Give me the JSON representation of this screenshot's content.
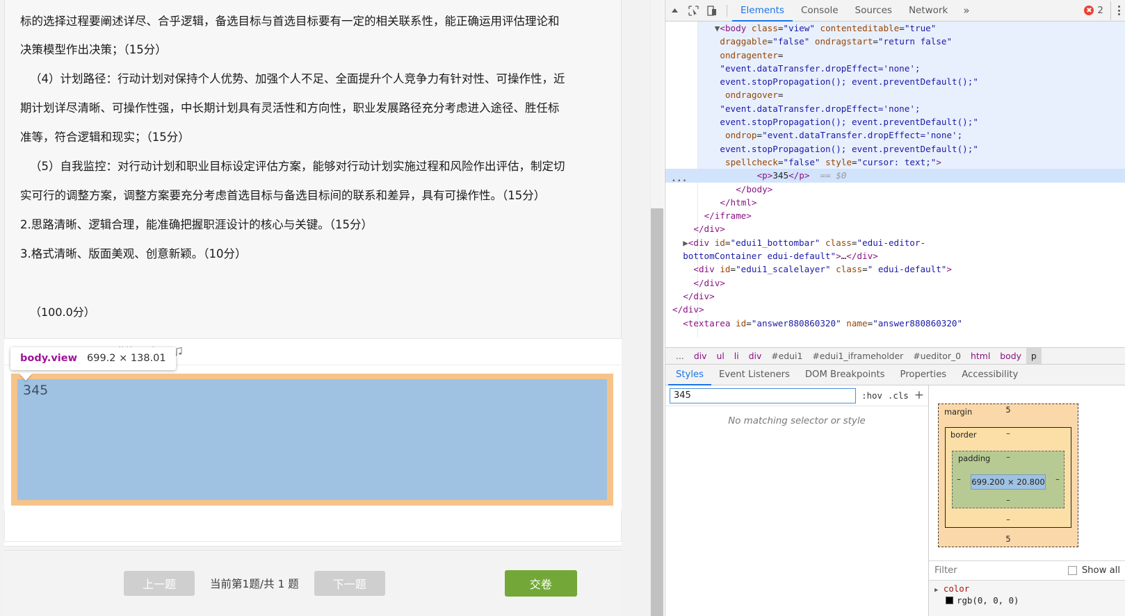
{
  "exam": {
    "paragraphs": [
      "标的选择过程要阐述详尽、合乎逻辑，备选目标与首选目标要有一定的相关联系性，能正确运用评估理论和",
      "决策模型作出决策；（15分）",
      "（4）计划路径：行动计划对保持个人优势、加强个人不足、全面提升个人竞争力有针对性、可操作性，近",
      "期计划详尽清晰、可操作性强，中长期计划具有灵活性和方向性，职业发展路径充分考虑进入途径、胜任标",
      "准等，符合逻辑和现实；（15分）",
      "（5）自我监控：对行动计划和职业目标设定评估方案，能够对行动计划实施过程和风险作出评估，制定切",
      "实可行的调整方案，调整方案要充分考虑首选目标与备选目标间的联系和差异，具有可操作性。（15分）",
      "2.思路清晰、逻辑合理，能准确把握职涯设计的核心与关键。（15分）",
      "3.格式清晰、版面美观、创意新颖。（10分）"
    ],
    "total_score": "（100.0分）",
    "editor": {
      "toolbar": {
        "attachment_label": "附件",
        "mic_icon": "microphone-icon",
        "music_icon": "music-note-icon"
      },
      "answer_text": "345"
    },
    "footer": {
      "prev_label": "上一题",
      "counter": "当前第1题/共 1 题",
      "next_label": "下一题",
      "submit_label": "交卷"
    }
  },
  "inspect_tooltip": {
    "selector": "body.view",
    "dimensions": "699.2 × 138.01"
  },
  "devtools": {
    "toolbar": {
      "inspect_icon": "inspect-element-icon",
      "device_icon": "device-toolbar-icon",
      "tabs": [
        {
          "label": "Elements",
          "active": true
        },
        {
          "label": "Console",
          "active": false
        },
        {
          "label": "Sources",
          "active": false
        },
        {
          "label": "Network",
          "active": false
        }
      ],
      "more_tabs_icon": "chevron-double-right-icon",
      "error_count": "2",
      "kebab_icon": "more-options-icon",
      "collapse_icon": "collapse-triangle-icon"
    },
    "dom_lines": [
      {
        "indent": 8,
        "segments": [
          {
            "t": "tri",
            "v": "▼"
          },
          {
            "t": "pk",
            "v": "<body"
          },
          {
            "t": "attr",
            "v": " class"
          },
          {
            "t": "txt",
            "v": "="
          },
          {
            "t": "val",
            "v": "\"view\""
          },
          {
            "t": "attr",
            "v": " contenteditable"
          },
          {
            "t": "txt",
            "v": "="
          },
          {
            "t": "val",
            "v": "\"true\""
          }
        ]
      },
      {
        "indent": 9,
        "segments": [
          {
            "t": "attr",
            "v": "draggable"
          },
          {
            "t": "txt",
            "v": "="
          },
          {
            "t": "val",
            "v": "\"false\""
          },
          {
            "t": "attr",
            "v": " ondragstart"
          },
          {
            "t": "txt",
            "v": "="
          },
          {
            "t": "val",
            "v": "\"return false\""
          }
        ]
      },
      {
        "indent": 9,
        "segments": [
          {
            "t": "attr",
            "v": "ondragenter"
          },
          {
            "t": "txt",
            "v": "="
          }
        ]
      },
      {
        "indent": 9,
        "segments": [
          {
            "t": "val",
            "v": "\"event.dataTransfer.dropEffect='none';"
          }
        ]
      },
      {
        "indent": 9,
        "segments": [
          {
            "t": "val",
            "v": "event.stopPropagation(); event.preventDefault();\""
          }
        ]
      },
      {
        "indent": 10,
        "segments": [
          {
            "t": "attr",
            "v": "ondragover"
          },
          {
            "t": "txt",
            "v": "="
          }
        ]
      },
      {
        "indent": 9,
        "segments": [
          {
            "t": "val",
            "v": "\"event.dataTransfer.dropEffect='none';"
          }
        ]
      },
      {
        "indent": 9,
        "segments": [
          {
            "t": "val",
            "v": "event.stopPropagation(); event.preventDefault();\""
          }
        ]
      },
      {
        "indent": 10,
        "segments": [
          {
            "t": "attr",
            "v": "ondrop"
          },
          {
            "t": "txt",
            "v": "="
          },
          {
            "t": "val",
            "v": "\"event.dataTransfer.dropEffect='none';"
          }
        ]
      },
      {
        "indent": 9,
        "segments": [
          {
            "t": "val",
            "v": "event.stopPropagation(); event.preventDefault();\""
          }
        ]
      },
      {
        "indent": 10,
        "segments": [
          {
            "t": "attr",
            "v": "spellcheck"
          },
          {
            "t": "txt",
            "v": "="
          },
          {
            "t": "val",
            "v": "\"false\""
          },
          {
            "t": "attr",
            "v": " style"
          },
          {
            "t": "txt",
            "v": "="
          },
          {
            "t": "val",
            "v": "\"cursor: text;\""
          },
          {
            "t": "pk",
            "v": ">"
          }
        ]
      },
      {
        "indent": 16,
        "selected": true,
        "segments": [
          {
            "t": "pk",
            "v": "<p>"
          },
          {
            "t": "txt",
            "v": "345"
          },
          {
            "t": "pk",
            "v": "</p>"
          },
          {
            "t": "eq",
            "v": "  == $0"
          }
        ]
      },
      {
        "indent": 12,
        "segments": [
          {
            "t": "pk",
            "v": "</body>"
          }
        ]
      },
      {
        "indent": 9,
        "segments": [
          {
            "t": "pk",
            "v": "</html>"
          }
        ]
      },
      {
        "indent": 6,
        "segments": [
          {
            "t": "pk",
            "v": "</iframe>"
          }
        ]
      },
      {
        "indent": 4,
        "segments": [
          {
            "t": "pk",
            "v": "</div>"
          }
        ]
      },
      {
        "indent": 2,
        "segments": [
          {
            "t": "tri",
            "v": "▶"
          },
          {
            "t": "pk",
            "v": "<div"
          },
          {
            "t": "attr",
            "v": " id"
          },
          {
            "t": "txt",
            "v": "="
          },
          {
            "t": "val",
            "v": "\"edui1_bottombar\""
          },
          {
            "t": "attr",
            "v": " class"
          },
          {
            "t": "txt",
            "v": "="
          },
          {
            "t": "val",
            "v": "\"edui-editor-"
          }
        ]
      },
      {
        "indent": 2,
        "segments": [
          {
            "t": "val",
            "v": "bottomContainer edui-default\""
          },
          {
            "t": "pk",
            "v": ">"
          },
          {
            "t": "txt",
            "v": "…"
          },
          {
            "t": "pk",
            "v": "</div>"
          }
        ]
      },
      {
        "indent": 4,
        "segments": [
          {
            "t": "pk",
            "v": "<div"
          },
          {
            "t": "attr",
            "v": " id"
          },
          {
            "t": "txt",
            "v": "="
          },
          {
            "t": "val",
            "v": "\"edui1_scalelayer\""
          },
          {
            "t": "attr",
            "v": " class"
          },
          {
            "t": "txt",
            "v": "="
          },
          {
            "t": "val",
            "v": "\" edui-default\""
          },
          {
            "t": "pk",
            "v": ">"
          }
        ]
      },
      {
        "indent": 4,
        "segments": [
          {
            "t": "pk",
            "v": "</div>"
          }
        ]
      },
      {
        "indent": 2,
        "segments": [
          {
            "t": "pk",
            "v": "</div>"
          }
        ]
      },
      {
        "indent": 0,
        "segments": [
          {
            "t": "pk",
            "v": "</div>"
          }
        ]
      },
      {
        "indent": 2,
        "segments": [
          {
            "t": "pk",
            "v": "<textarea"
          },
          {
            "t": "attr",
            "v": " id"
          },
          {
            "t": "txt",
            "v": "="
          },
          {
            "t": "val",
            "v": "\"answer880860320\""
          },
          {
            "t": "attr",
            "v": " name"
          },
          {
            "t": "txt",
            "v": "="
          },
          {
            "t": "val",
            "v": "\"answer880860320\""
          }
        ]
      }
    ],
    "breadcrumb": [
      {
        "label": "...",
        "style": "gray"
      },
      {
        "label": "div",
        "style": "pink"
      },
      {
        "label": "ul",
        "style": "pink"
      },
      {
        "label": "li",
        "style": "pink"
      },
      {
        "label": "div",
        "style": "pink"
      },
      {
        "label": "#edui1",
        "style": "gray"
      },
      {
        "label": "#edui1_iframeholder",
        "style": "gray"
      },
      {
        "label": "#ueditor_0",
        "style": "gray"
      },
      {
        "label": "html",
        "style": "pink"
      },
      {
        "label": "body",
        "style": "pink"
      },
      {
        "label": "p",
        "style": "active"
      }
    ],
    "styles_tabs": [
      {
        "label": "Styles",
        "active": true
      },
      {
        "label": "Event Listeners",
        "active": false
      },
      {
        "label": "DOM Breakpoints",
        "active": false
      },
      {
        "label": "Properties",
        "active": false
      },
      {
        "label": "Accessibility",
        "active": false
      }
    ],
    "styles": {
      "filter_value": "345",
      "filter_placeholder": "Filter",
      "hov_label": ":hov",
      "cls_label": ".cls",
      "add_rule_icon": "plus-icon",
      "no_match_message": "No matching selector or style"
    },
    "box_model": {
      "margin_label": "margin",
      "margin_top": "5",
      "margin_right": "–",
      "margin_bottom": "5",
      "margin_left": "–",
      "border_label": "border",
      "border_top": "–",
      "border_right": "–",
      "border_bottom": "–",
      "border_left": "–",
      "padding_label": "padding",
      "padding_top": "–",
      "padding_right": "–",
      "padding_bottom": "–",
      "padding_left": "–",
      "content_size": "699.200 × 20.800"
    },
    "computed": {
      "filter_placeholder": "Filter",
      "show_all_label": "Show all",
      "properties": [
        {
          "name": "color",
          "value": "rgb(0, 0, 0)",
          "swatch": "#000000"
        }
      ]
    }
  },
  "colors": {
    "accent_blue": "#1a73e8",
    "submit_green": "#73a839",
    "margin_highlight": "#f6c389",
    "content_highlight": "#9fc2e2",
    "error_red": "#e94235"
  }
}
